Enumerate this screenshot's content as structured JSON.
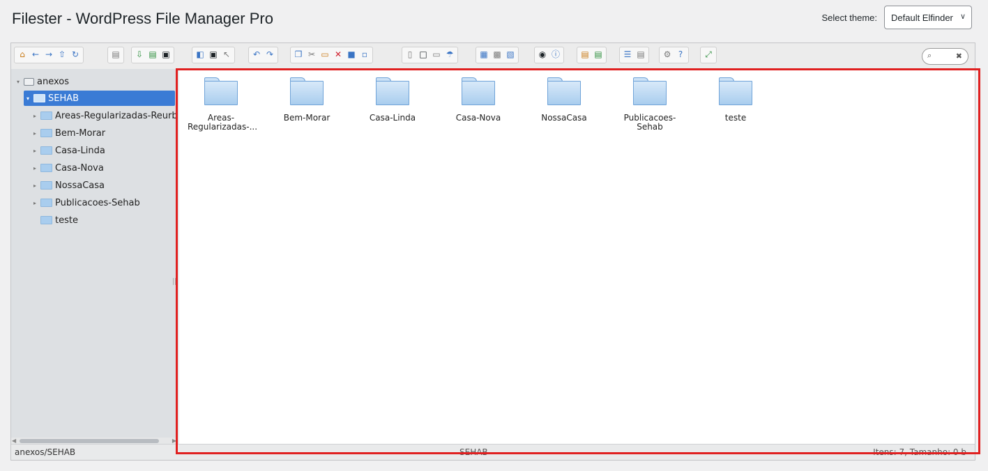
{
  "header": {
    "title": "Filester - WordPress File Manager Pro",
    "theme_label": "Select theme:",
    "theme_value": "Default Elfinder"
  },
  "toolbar": {
    "search_placeholder": ""
  },
  "tree": {
    "root": "anexos",
    "current": "SEHAB",
    "items": [
      {
        "label": "Areas-Regularizadas-Reurb",
        "expandable": true
      },
      {
        "label": "Bem-Morar",
        "expandable": true
      },
      {
        "label": "Casa-Linda",
        "expandable": true
      },
      {
        "label": "Casa-Nova",
        "expandable": true
      },
      {
        "label": "NossaCasa",
        "expandable": true
      },
      {
        "label": "Publicacoes-Sehab",
        "expandable": true
      },
      {
        "label": "teste",
        "expandable": false
      }
    ]
  },
  "files": [
    {
      "line1": "Areas-",
      "line2": "Regularizadas-..."
    },
    {
      "line1": "Bem-Morar",
      "line2": ""
    },
    {
      "line1": "Casa-Linda",
      "line2": ""
    },
    {
      "line1": "Casa-Nova",
      "line2": ""
    },
    {
      "line1": "NossaCasa",
      "line2": ""
    },
    {
      "line1": "Publicacoes-",
      "line2": "Sehab"
    },
    {
      "line1": "teste",
      "line2": ""
    }
  ],
  "status": {
    "path": "anexos/SEHAB",
    "cwd": "SEHAB",
    "info": "Itens: 7, Tamanho: 0 b"
  },
  "colors": {
    "active": "#3a7bd5",
    "highlight": "#e02020"
  }
}
